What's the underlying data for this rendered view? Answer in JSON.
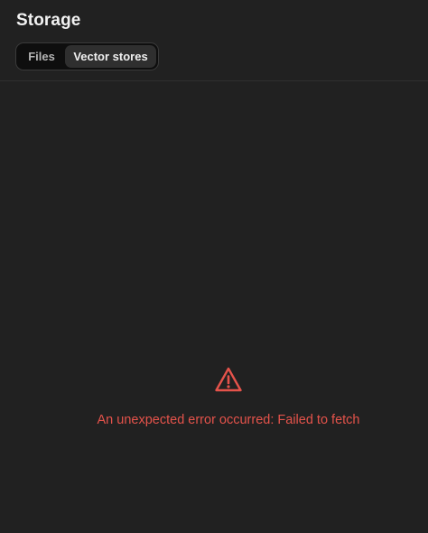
{
  "header": {
    "title": "Storage"
  },
  "tabs": [
    {
      "label": "Files",
      "selected": false
    },
    {
      "label": "Vector stores",
      "selected": true
    }
  ],
  "error": {
    "icon": "warning-triangle-icon",
    "message": "An unexpected error occurred: Failed to fetch"
  },
  "colors": {
    "background": "#212121",
    "error": "#e5534b",
    "selected_tab": "#2f2f2f"
  }
}
